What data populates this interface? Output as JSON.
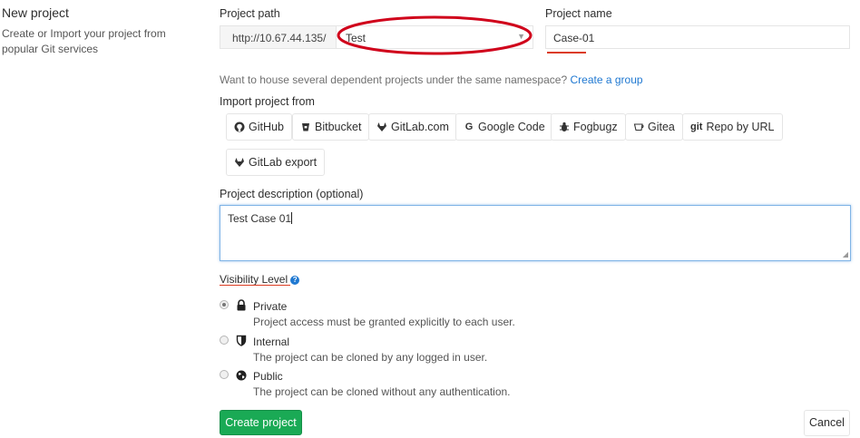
{
  "sidebar": {
    "title": "New project",
    "description": "Create or Import your project from popular Git services"
  },
  "project_path": {
    "label": "Project path",
    "prefix": "http://10.67.44.135/",
    "namespace": "Test"
  },
  "project_name": {
    "label": "Project name",
    "value": "Case-01"
  },
  "namespace_hint": {
    "text": "Want to house several dependent projects under the same namespace?",
    "link": "Create a group"
  },
  "import": {
    "label": "Import project from",
    "sources": [
      {
        "label": "GitHub",
        "icon": "github-icon"
      },
      {
        "label": "Bitbucket",
        "icon": "bitbucket-icon"
      },
      {
        "label": "GitLab.com",
        "icon": "gitlab-icon"
      },
      {
        "label": "Google Code",
        "icon": "google-icon"
      },
      {
        "label": "Fogbugz",
        "icon": "bug-icon"
      },
      {
        "label": "Gitea",
        "icon": "gitea-icon"
      },
      {
        "label": "Repo by URL",
        "icon": "git-icon",
        "icon_text": "git"
      },
      {
        "label": "GitLab export",
        "icon": "gitlab-icon"
      }
    ]
  },
  "description": {
    "label": "Project description (optional)",
    "value": "Test Case 01"
  },
  "visibility": {
    "label": "Visibility Level",
    "help_glyph": "?",
    "selected": "Private",
    "options": [
      {
        "title": "Private",
        "description": "Project access must be granted explicitly to each user.",
        "icon": "lock-icon"
      },
      {
        "title": "Internal",
        "description": "The project can be cloned by any logged in user.",
        "icon": "shield-icon"
      },
      {
        "title": "Public",
        "description": "The project can be cloned without any authentication.",
        "icon": "globe-icon"
      }
    ]
  },
  "actions": {
    "create": "Create project",
    "cancel": "Cancel"
  },
  "colors": {
    "primary_green": "#1aaa55",
    "link_blue": "#1f78d1",
    "annotation_red": "#d0021b",
    "error_underline": "#db3b21"
  }
}
